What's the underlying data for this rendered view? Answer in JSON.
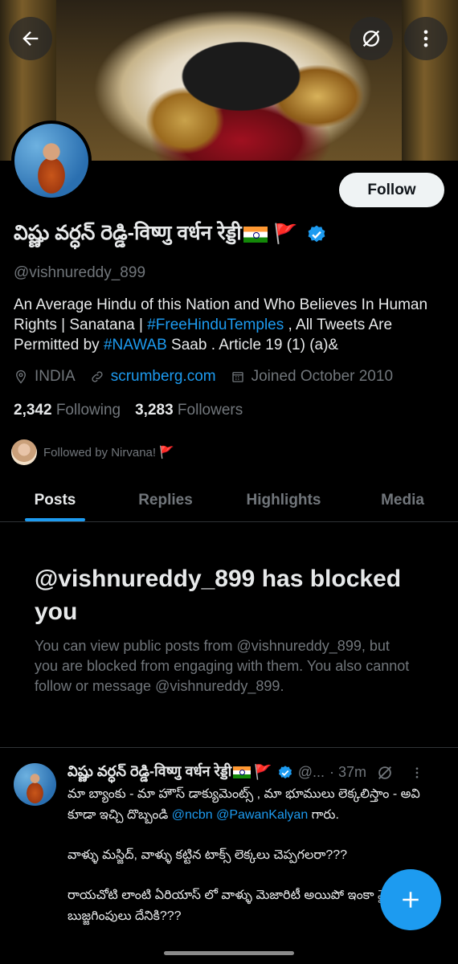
{
  "profile": {
    "name": "విష్ణు వర్ధన్ రెడ్డి-विष्णु वर्धन रेड्डी",
    "handle": "@vishnureddy_899",
    "bio_parts": {
      "part1": "An Average Hindu of this Nation and Who Believes In Human Rights | Sanatana | ",
      "tag1": "#FreeHinduTemples",
      "part2": " , All Tweets Are Permitted by ",
      "tag2": "#NAWAB",
      "part3": " Saab . Article 19 (1) (a)&"
    },
    "location": "INDIA",
    "website": "scrumberg.com",
    "joined": "Joined October 2010",
    "following_count": "2,342",
    "following_label": "Following",
    "followers_count": "3,283",
    "followers_label": "Followers",
    "followed_by": "Followed by Nirvana! 🚩",
    "follow_button": "Follow"
  },
  "tabs": [
    "Posts",
    "Replies",
    "Highlights",
    "Media"
  ],
  "blocked": {
    "title": "@vishnureddy_899 has blocked you",
    "message": "You can view public posts from @vishnureddy_899, but you are blocked from engaging with them. You also cannot follow or message @vishnureddy_899."
  },
  "tweet": {
    "author": "విష్ణు వర్ధన్ రెడ్డి-विष्णु वर्धन रेड्डी",
    "handle_short": "@...",
    "time": "· 37m",
    "line1a": "మా బ్యాంకు - మా హౌస్ డాక్యుమెంట్స్ , మా భూములు లెక్కలిస్తాం - అవి కూడా ఇచ్చి దొబ్బండి ",
    "mention1": "@ncbn",
    "mention2": "@PawanKalyan",
    "line1b": " గారు.",
    "para2": "వాళ్ళు మస్జిద్, వాళ్ళు కట్టిన టాక్స్ లెక్కలు చెప్పగలరా???",
    "para3": "రాయచోటి లాంటి ఏరియాస్ లో వాళ్ళు మెజారిటీ అయిపో ఇంకా మైనారిటీ బుజ్జగింపులు దేనికి???"
  },
  "icons": {
    "back": "arrow-left-icon",
    "grok": "grok-icon",
    "more": "more-vertical-icon",
    "location": "location-pin-icon",
    "link": "link-icon",
    "calendar": "calendar-icon",
    "verified": "verified-badge-icon",
    "compose": "plus-icon"
  },
  "colors": {
    "accent": "#1d9bf0",
    "background": "#000000",
    "text": "#e7e9ea",
    "muted": "#71767b"
  }
}
